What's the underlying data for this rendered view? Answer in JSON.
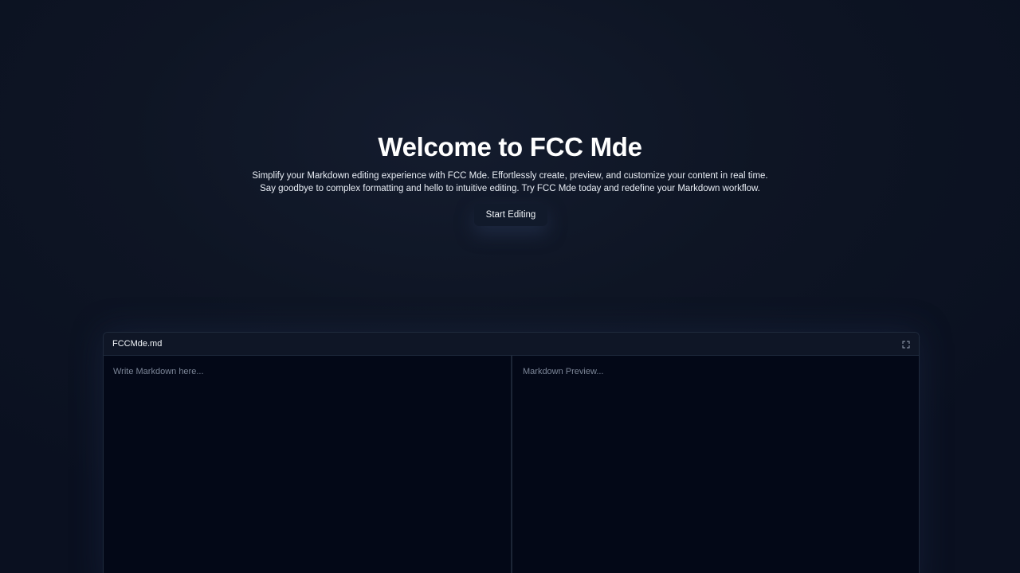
{
  "hero": {
    "title": "Welcome to FCC Mde",
    "description_line1": "Simplify your Markdown editing experience with FCC Mde. Effortlessly create, preview, and customize your content in real time.",
    "description_line2": "Say goodbye to complex formatting and hello to intuitive editing. Try FCC Mde today and redefine your Markdown workflow.",
    "cta_label": "Start Editing"
  },
  "editor": {
    "file_name": "FCCMde.md",
    "expand_icon": "expand-icon",
    "input_placeholder": "Write Markdown here...",
    "input_value": "",
    "preview_placeholder": "Markdown Preview..."
  },
  "colors": {
    "background": "#0a1020",
    "panel": "#030817",
    "header": "#0f1626",
    "border": "#1f2a3c",
    "text": "#f1f5f9",
    "muted": "#7c8698"
  }
}
